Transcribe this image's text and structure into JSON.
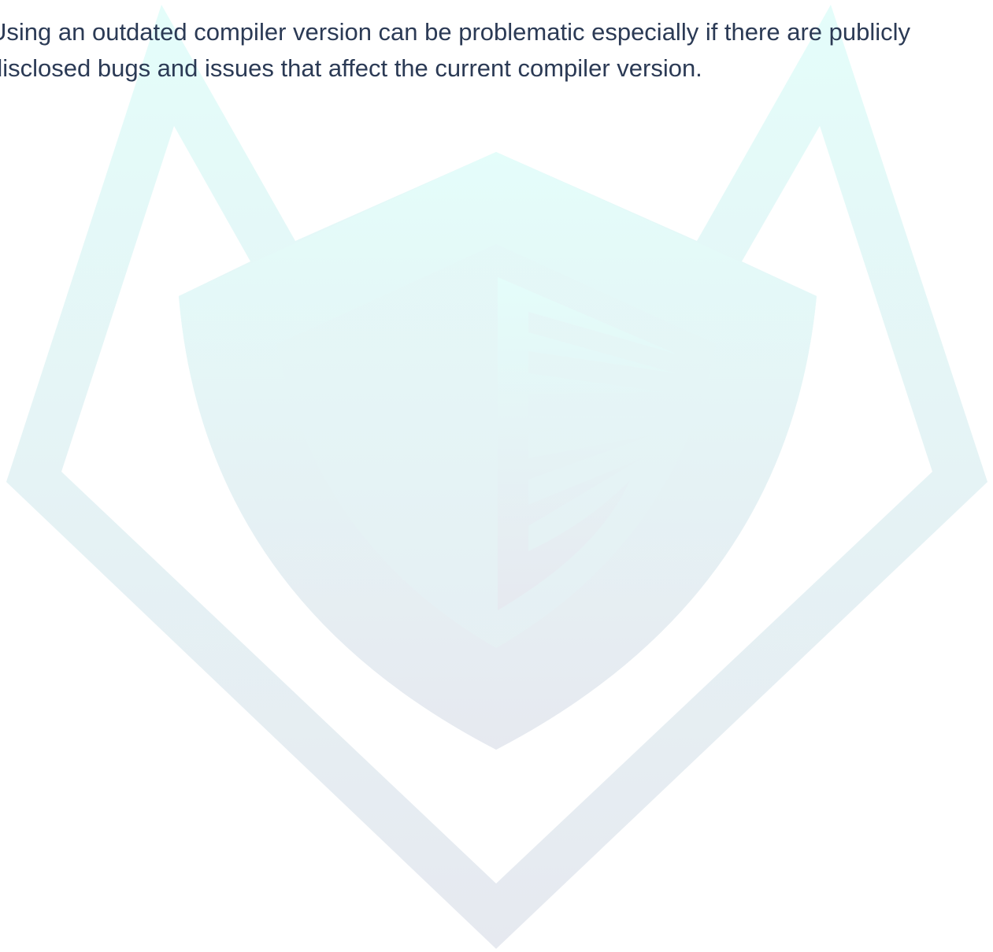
{
  "paragraph": {
    "line_1": "Using an outdated compiler version can be problematic especially if there are publicly",
    "line_2": "disclosed bugs and issues that affect the current compiler version."
  },
  "watermark": {
    "icon": "fox-shield-logo-watermark-icon",
    "colors": {
      "top": "#e4fdfa",
      "bottom": "#e6e9f0"
    }
  }
}
